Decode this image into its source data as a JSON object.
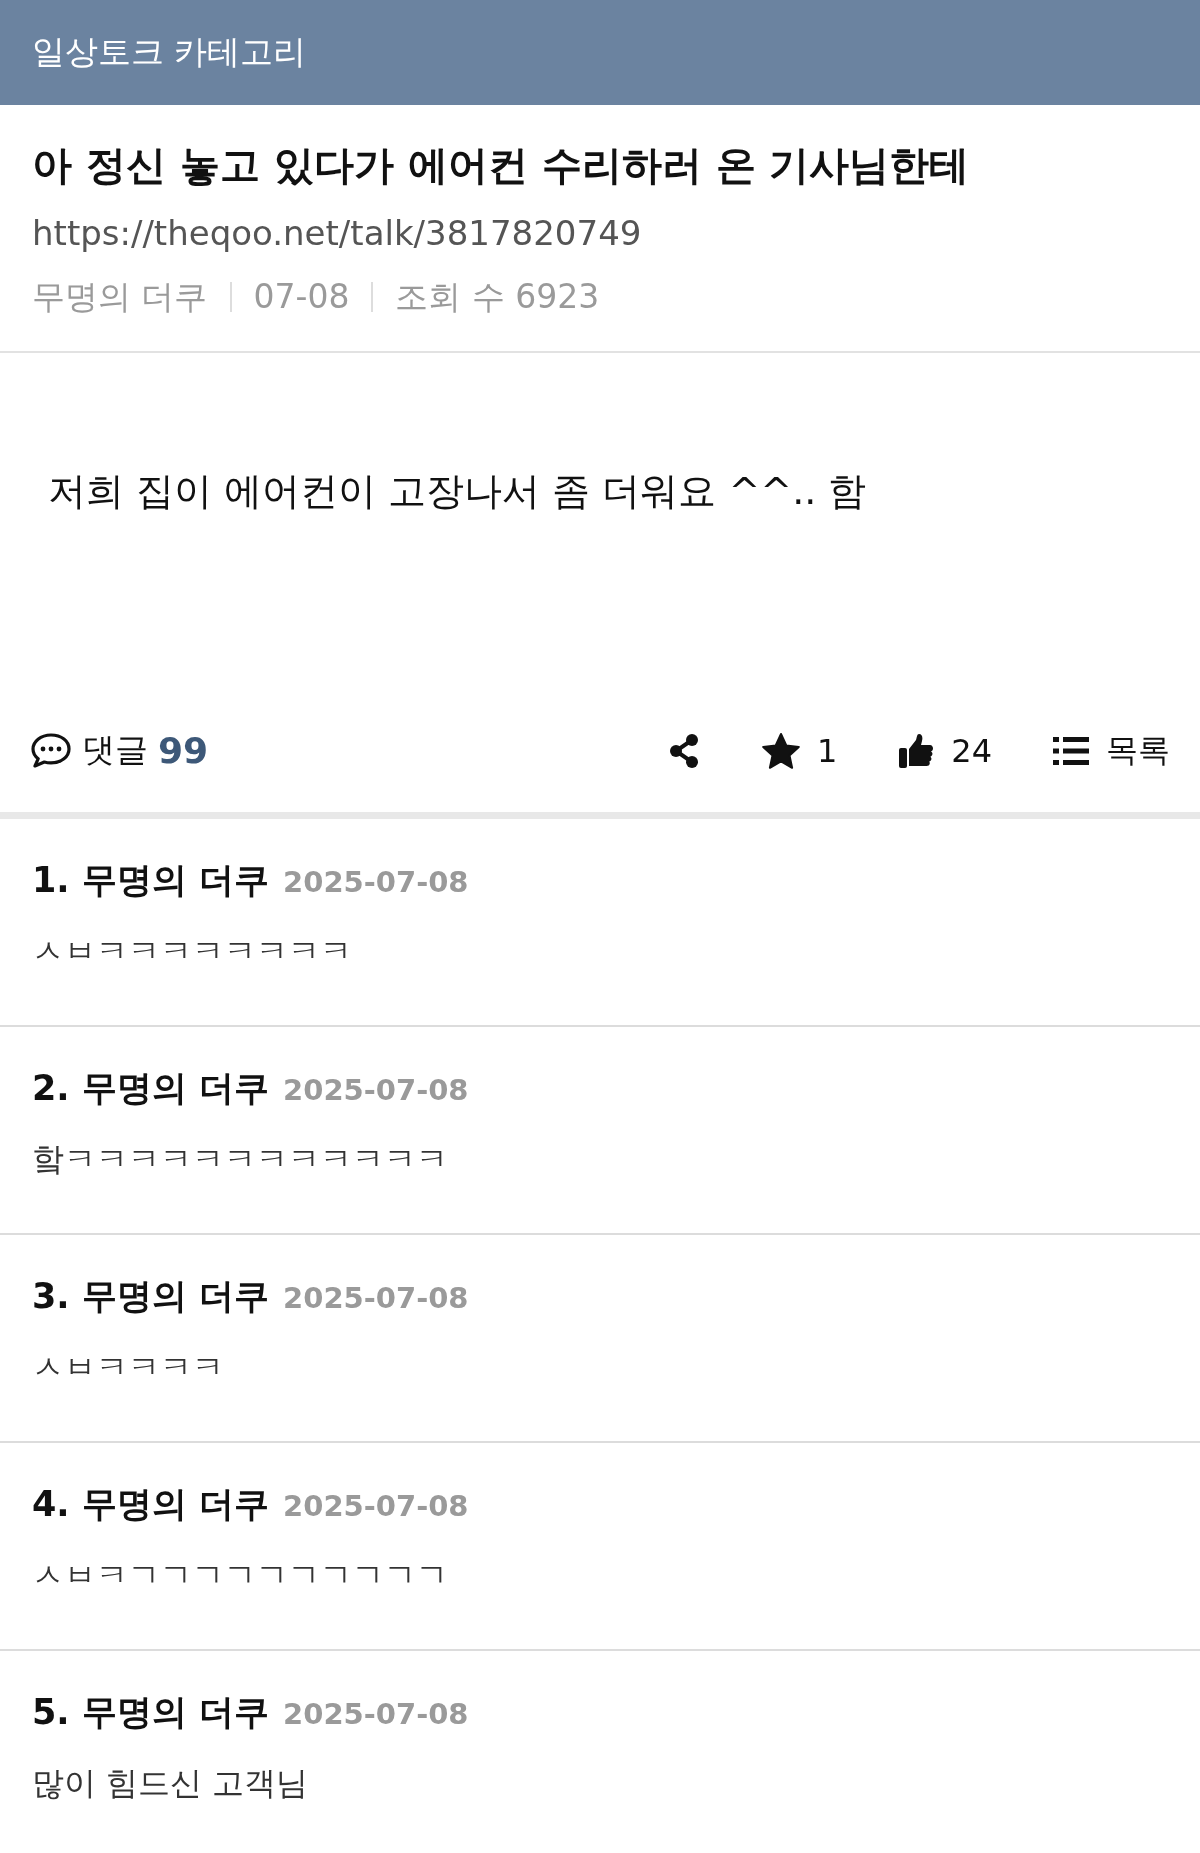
{
  "header": {
    "title": "일상토크 카테고리"
  },
  "post": {
    "title": "아 정신 놓고 있다가 에어컨 수리하러 온 기사님한테",
    "url": "https://theqoo.net/talk/3817820749",
    "author": "무명의 더쿠",
    "date": "07-08",
    "views": "조회 수 6923",
    "body": "저희 집이 에어컨이 고장나서 좀 더워요 ^^.. 함"
  },
  "actions": {
    "comments_label": "댓글",
    "comments_count": "99",
    "buttons": [
      {
        "kind": "share"
      },
      {
        "kind": "star",
        "label": "1"
      },
      {
        "kind": "like",
        "label": "24"
      },
      {
        "kind": "list",
        "label": "목록"
      }
    ]
  },
  "comments": [
    {
      "number": "1.",
      "author": "무명의 더쿠",
      "date": "2025-07-08",
      "text": "ㅅㅂㅋㅋㅋㅋㅋㅋㅋㅋ"
    },
    {
      "number": "2.",
      "author": "무명의 더쿠",
      "date": "2025-07-08",
      "text": "핰ㅋㅋㅋㅋㅋㅋㅋㅋㅋㅋㅋㅋ"
    },
    {
      "number": "3.",
      "author": "무명의 더쿠",
      "date": "2025-07-08",
      "text": "ㅅㅂㅋㅋㅋㅋ"
    },
    {
      "number": "4.",
      "author": "무명의 더쿠",
      "date": "2025-07-08",
      "text": "ㅅㅂㅋㄱㄱㄱㄱㄱㄱㄱㄱㄱㄱ"
    },
    {
      "number": "5.",
      "author": "무명의 더쿠",
      "date": "2025-07-08",
      "text": "많이 힘드신 고객님"
    }
  ]
}
